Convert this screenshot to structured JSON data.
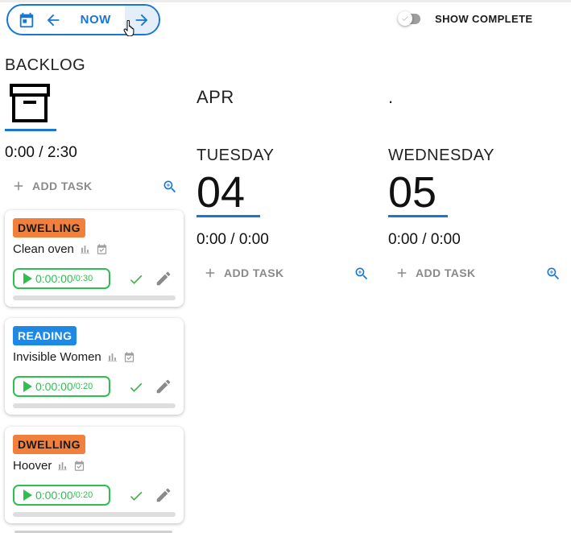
{
  "nav": {
    "now_label": "NOW"
  },
  "toggle": {
    "label": "SHOW COMPLETE",
    "checked": false
  },
  "backlog": {
    "title": "BACKLOG",
    "time": "0:00 / 2:30",
    "add_task": "ADD TASK",
    "cards": [
      {
        "tag": "DWELLING",
        "tag_color": "#f0803c",
        "title": "Clean oven",
        "elapsed": "0:00:00",
        "estimate": "/0:30",
        "progress": 0
      },
      {
        "tag": "READING",
        "tag_color": "#1e88e5",
        "title": "Invisible Women",
        "elapsed": "0:00:00",
        "estimate": "/0:20",
        "progress": 0
      },
      {
        "tag": "DWELLING",
        "tag_color": "#f0803c",
        "title": "Hoover",
        "elapsed": "0:00:00",
        "estimate": "/0:20",
        "progress": 0
      }
    ]
  },
  "days": [
    {
      "month": "APR",
      "dayname": "TUESDAY",
      "daynum": "04",
      "time": "0:00 / 0:00",
      "add_task": "ADD TASK"
    },
    {
      "month": ".",
      "dayname": "WEDNESDAY",
      "daynum": "05",
      "time": "0:00 / 0:00",
      "add_task": "ADD TASK"
    }
  ],
  "colors": {
    "accent": "#1976d2",
    "timer_green": "#2fbf50",
    "check_green": "#4caf50"
  }
}
